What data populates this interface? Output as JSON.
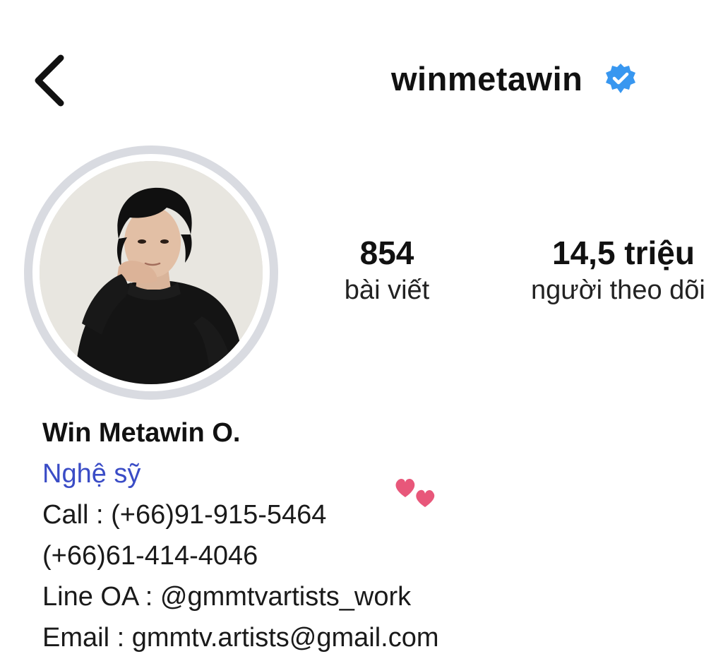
{
  "header": {
    "username": "winmetawin",
    "verified_icon": "verified-badge-icon",
    "back_icon": "chevron-left-icon",
    "verified_color": "#3897f0"
  },
  "profile": {
    "avatar_icon": "profile-photo",
    "stats": [
      {
        "value": "854",
        "label": "bài viết"
      },
      {
        "value": "14,5 triệu",
        "label": "người theo dõi"
      }
    ]
  },
  "bio": {
    "name": "Win Metawin O.",
    "category": "Nghệ sỹ",
    "lines": [
      "Call : (+66)91-915-5464",
      "(+66)61-414-4046",
      "Line OA : @gmmtvartists_work",
      "Email : gmmtv.artists@gmail.com"
    ],
    "emoji": "heart-icons",
    "category_color": "#3a4cc6"
  }
}
